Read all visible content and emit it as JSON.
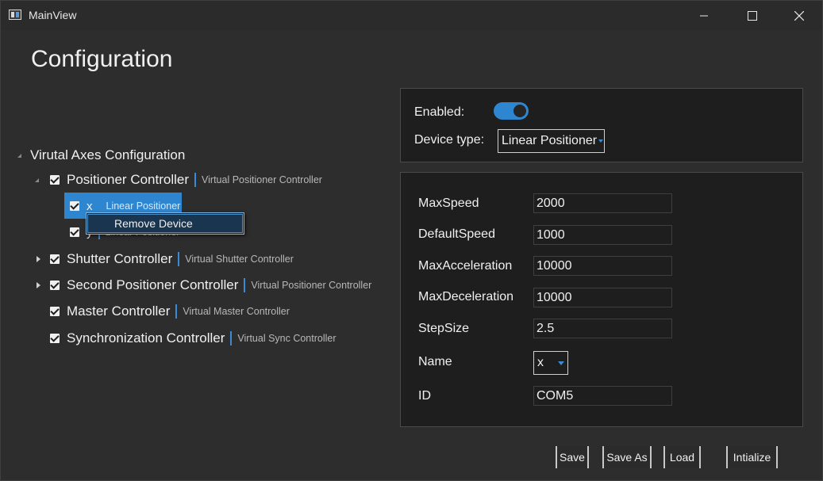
{
  "window": {
    "title": "MainView"
  },
  "page": {
    "title": "Configuration"
  },
  "tree": {
    "root_label": "Virutal Axes Configuration",
    "nodes": [
      {
        "label": "Positioner Controller",
        "sub": "Virtual Positioner Controller",
        "expanded": true
      },
      {
        "label": "Shutter Controller",
        "sub": "Virtual Shutter Controller",
        "expanded": false
      },
      {
        "label": "Second Positioner Controller",
        "sub": "Virtual Positioner Controller",
        "expanded": false
      },
      {
        "label": "Master Controller",
        "sub": "Virtual Master Controller"
      },
      {
        "label": "Synchronization Controller",
        "sub": "Virtual Sync Controller"
      }
    ],
    "children": [
      {
        "label": "x",
        "sub": "Linear Positioner",
        "selected": true
      },
      {
        "label": "y",
        "sub": "Linear Positioner"
      }
    ],
    "context_menu": {
      "item": "Remove Device"
    }
  },
  "device": {
    "enabled_label": "Enabled:",
    "enabled": true,
    "type_label": "Device type:",
    "type_value": "Linear Positioner"
  },
  "props": {
    "max_speed": {
      "label": "MaxSpeed",
      "value": "2000"
    },
    "default_speed": {
      "label": "DefaultSpeed",
      "value": "1000"
    },
    "max_acceleration": {
      "label": "MaxAcceleration",
      "value": "10000"
    },
    "max_deceleration": {
      "label": "MaxDeceleration",
      "value": "10000"
    },
    "step_size": {
      "label": "StepSize",
      "value": "2.5"
    },
    "name": {
      "label": "Name",
      "value": "x"
    },
    "id": {
      "label": "ID",
      "value": "COM5"
    }
  },
  "buttons": {
    "save": "Save",
    "save_as": "Save As",
    "load": "Load",
    "initialize": "Intialize"
  },
  "colors": {
    "accent": "#2f86d0",
    "background": "#2d2d2d",
    "panel": "#1e1e1e"
  }
}
